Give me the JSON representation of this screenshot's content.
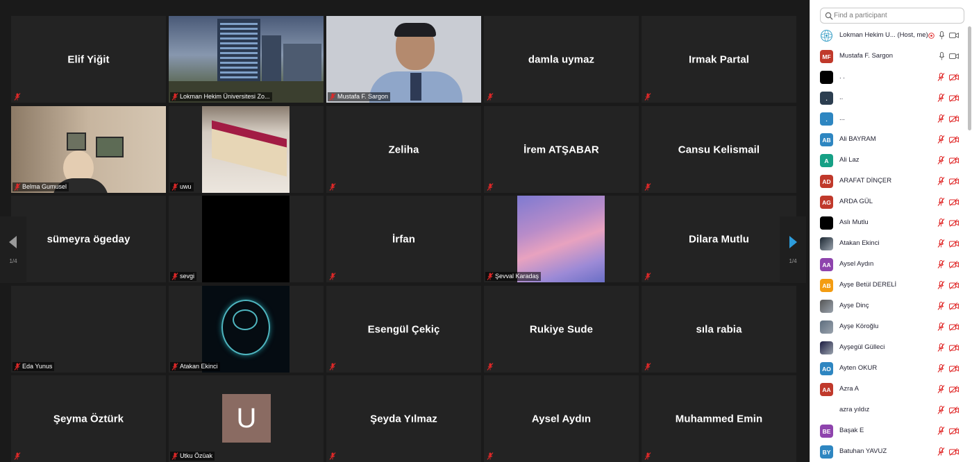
{
  "gallery": {
    "page_left": "1/4",
    "page_right": "1/4",
    "tiles": [
      {
        "id": "t0",
        "name": "Elif Yiğit",
        "label": ""
      },
      {
        "id": "t1",
        "name": "",
        "label": "Lokman Hekim Üniversitesi Zo..."
      },
      {
        "id": "t2",
        "name": "",
        "label": "Mustafa F. Sargon"
      },
      {
        "id": "t3",
        "name": "damla uymaz",
        "label": ""
      },
      {
        "id": "t4",
        "name": "Irmak Partal",
        "label": ""
      },
      {
        "id": "t5",
        "name": "",
        "label": "Belma Gumusel"
      },
      {
        "id": "t6",
        "name": "",
        "label": "uwu"
      },
      {
        "id": "t7",
        "name": "Zeliha",
        "label": ""
      },
      {
        "id": "t8",
        "name": "İrem ATŞABAR",
        "label": ""
      },
      {
        "id": "t9",
        "name": "Cansu Kelismail",
        "label": ""
      },
      {
        "id": "t10",
        "name": "sümeyra ögeday",
        "label": ""
      },
      {
        "id": "t11",
        "name": "",
        "label": "sevgi"
      },
      {
        "id": "t12",
        "name": "İrfan",
        "label": ""
      },
      {
        "id": "t13",
        "name": "",
        "label": "Şevval Karadaş"
      },
      {
        "id": "t14",
        "name": "Dilara Mutlu",
        "label": ""
      },
      {
        "id": "t15",
        "name": "",
        "label": "Eda Yunus"
      },
      {
        "id": "t16",
        "name": "",
        "label": "Atakan Ekinci"
      },
      {
        "id": "t17",
        "name": "Esengül Çekiç",
        "label": ""
      },
      {
        "id": "t18",
        "name": "Rukiye Sude",
        "label": ""
      },
      {
        "id": "t19",
        "name": "sıla rabia",
        "label": ""
      },
      {
        "id": "t20",
        "name": "Şeyma Öztürk",
        "label": ""
      },
      {
        "id": "t21",
        "name": "",
        "label": "Utku Özüak",
        "avatar_letter": "U"
      },
      {
        "id": "t22",
        "name": "Şeyda Yılmaz",
        "label": ""
      },
      {
        "id": "t23",
        "name": "Aysel Aydın",
        "label": ""
      },
      {
        "id": "t24",
        "name": "Muhammed Emin",
        "label": ""
      }
    ]
  },
  "sidebar": {
    "search_placeholder": "Find a participant",
    "participants": [
      {
        "name": "Lokman Hekim U... (Host, me)",
        "initials": "",
        "color": "#ffffff",
        "avatar": "logo",
        "mic": "on",
        "video": "on",
        "host": true
      },
      {
        "name": "Mustafa F. Sargon",
        "initials": "MF",
        "color": "#c0392b",
        "mic": "on",
        "video": "on"
      },
      {
        "name": ". .",
        "initials": "",
        "color": "#000000",
        "mic": "off",
        "video": "off"
      },
      {
        "name": "..",
        "initials": ".",
        "color": "#2c3e50",
        "mic": "off",
        "video": "off"
      },
      {
        "name": "...",
        "initials": ".",
        "color": "#2e86c1",
        "mic": "off",
        "video": "off"
      },
      {
        "name": "Ali BAYRAM",
        "initials": "AB",
        "color": "#2e86c1",
        "mic": "off",
        "video": "off"
      },
      {
        "name": "Ali Laz",
        "initials": "A",
        "color": "#16a085",
        "mic": "off",
        "video": "off"
      },
      {
        "name": "ARAFAT DİNÇER",
        "initials": "AD",
        "color": "#c0392b",
        "mic": "off",
        "video": "off"
      },
      {
        "name": "ARDA GÜL",
        "initials": "AG",
        "color": "#c0392b",
        "mic": "off",
        "video": "off"
      },
      {
        "name": "Aslı Mutlu",
        "initials": "",
        "color": "#000000",
        "mic": "off",
        "video": "off"
      },
      {
        "name": "Atakan Ekinci",
        "initials": "",
        "color": "#1b2631",
        "avatar": "photo",
        "mic": "off",
        "video": "off"
      },
      {
        "name": "Aysel Aydın",
        "initials": "AA",
        "color": "#8e44ad",
        "mic": "off",
        "video": "off"
      },
      {
        "name": "Ayşe Betül DERELİ",
        "initials": "AB",
        "color": "#f39c12",
        "mic": "off",
        "video": "off"
      },
      {
        "name": "Ayşe Dinç",
        "initials": "",
        "color": "#555555",
        "avatar": "photo",
        "mic": "off",
        "video": "off"
      },
      {
        "name": "Ayşe Köroğlu",
        "initials": "",
        "color": "#5d6d7e",
        "avatar": "photo",
        "mic": "off",
        "video": "off"
      },
      {
        "name": "Ayşegül Gülleci",
        "initials": "",
        "color": "#1a1a40",
        "avatar": "photo",
        "mic": "off",
        "video": "off"
      },
      {
        "name": "Ayten OKUR",
        "initials": "AO",
        "color": "#2e86c1",
        "mic": "off",
        "video": "off"
      },
      {
        "name": "Azra A",
        "initials": "AA",
        "color": "#c0392b",
        "mic": "off",
        "video": "off"
      },
      {
        "name": "azra yıldız",
        "initials": "",
        "color": "#ffffff",
        "mic": "off",
        "video": "off"
      },
      {
        "name": "Başak E",
        "initials": "BE",
        "color": "#8e44ad",
        "mic": "off",
        "video": "off"
      },
      {
        "name": "Batuhan YAVUZ",
        "initials": "BY",
        "color": "#2e86c1",
        "mic": "off",
        "video": "off"
      }
    ]
  },
  "colors": {
    "active_speaker_border": "#c6dc5c",
    "mute_red": "#e02828",
    "arrow_blue": "#2d9cdb"
  }
}
